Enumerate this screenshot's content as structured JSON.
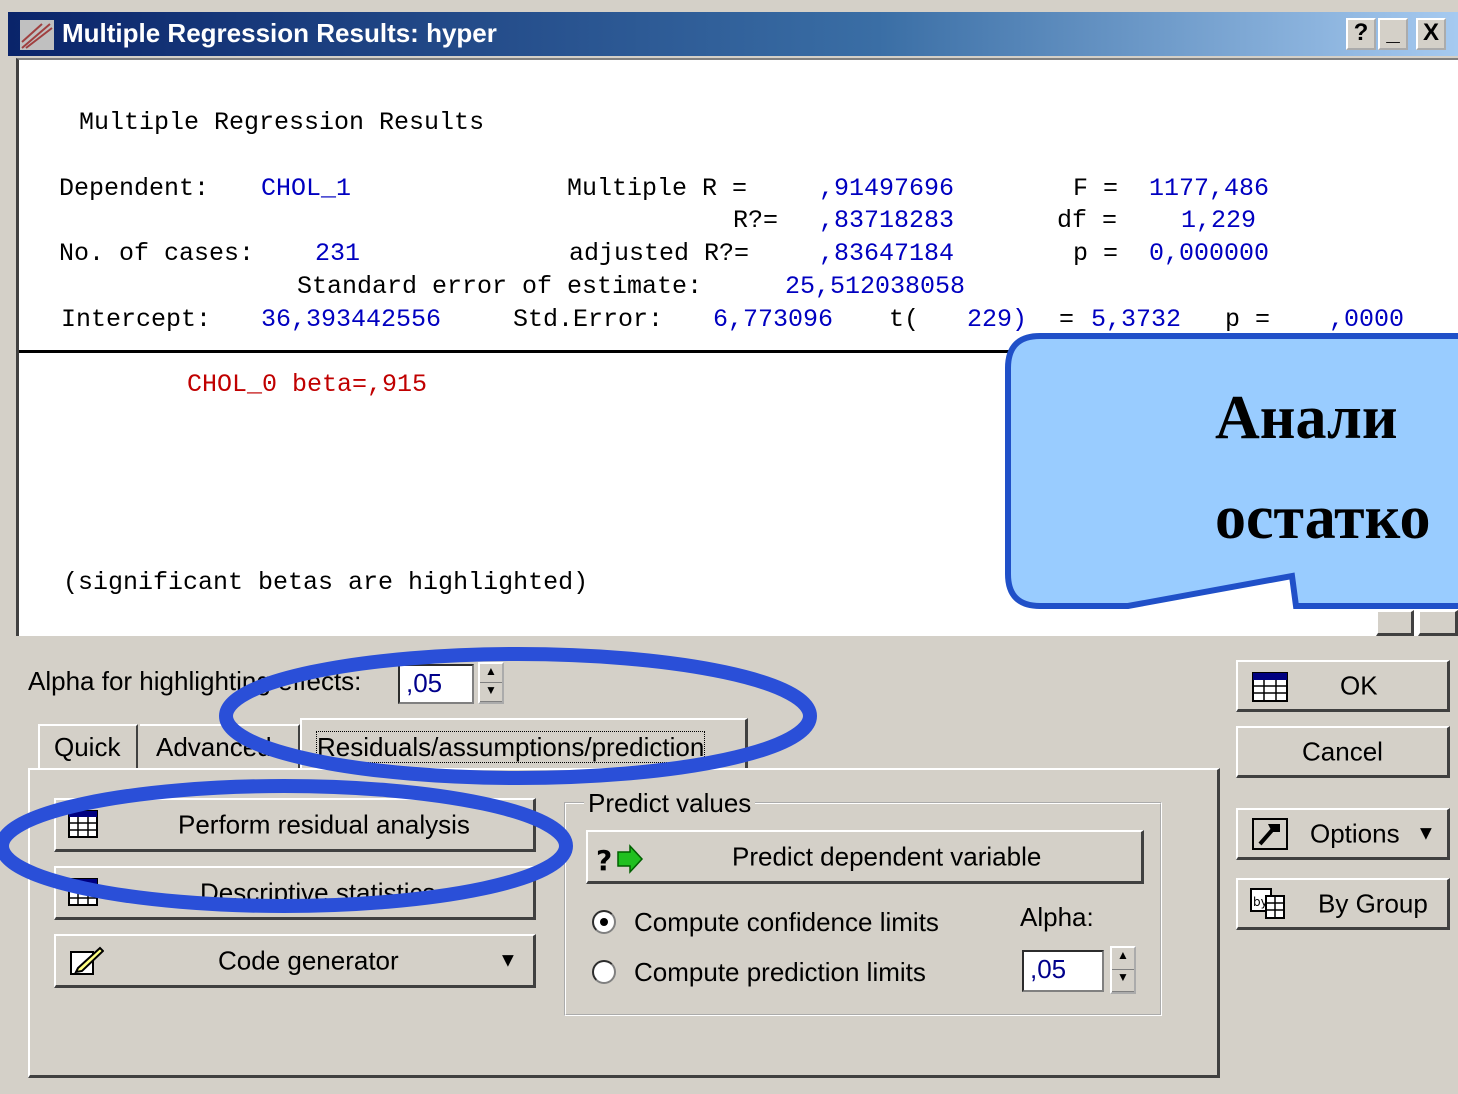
{
  "window": {
    "title": "Multiple Regression Results: hyper",
    "help_btn": "?",
    "min_btn": "_",
    "close_btn": "X"
  },
  "results": {
    "heading": "Multiple Regression Results",
    "dependent_label": "Dependent:",
    "dependent_value": "CHOL_1",
    "multiple_r_label": "Multiple R =",
    "multiple_r_value": ",91497696",
    "f_label": "F =",
    "f_value": "1177,486",
    "r2_label": "R?=",
    "r2_value": ",83718283",
    "df_label": "df =",
    "df_value": "1,229",
    "cases_label": "No. of cases:",
    "cases_value": "231",
    "adj_r2_label": "adjusted R?=",
    "adj_r2_value": ",83647184",
    "p_label": "p =",
    "p_value": "0,000000",
    "std_err_label": "Standard error of estimate:",
    "std_err_value": "25,512038058",
    "intercept_label": "Intercept:",
    "intercept_value": "36,393442556",
    "intercept_se_label": "Std.Error:",
    "intercept_se_value": "6,773096",
    "t_label": "t(",
    "t_df": "229)",
    "t_eq": "=",
    "t_value": "5,3732",
    "t_p_label": "p =",
    "t_p_value": ",0000",
    "beta_line": "CHOL_0 beta=,915",
    "footnote": "(significant betas are highlighted)"
  },
  "callout": {
    "line1": "Анали",
    "line2": "остатко"
  },
  "controls": {
    "alpha_label": "Alpha for highlighting effects:",
    "alpha_value": ",05",
    "tabs": [
      "Quick",
      "Advanced",
      "Residuals/assumptions/prediction"
    ],
    "perform_residual": "Perform residual analysis",
    "descriptive": "Descriptive statistics",
    "code_generator": "Code generator",
    "predict_group": "Predict values",
    "predict_dep": "Predict dependent variable",
    "confidence": "Compute confidence limits",
    "prediction": "Compute prediction limits",
    "alpha2_label": "Alpha:",
    "alpha2_value": ",05",
    "ok": "OK",
    "cancel": "Cancel",
    "options": "Options",
    "by_group": "By Group"
  }
}
